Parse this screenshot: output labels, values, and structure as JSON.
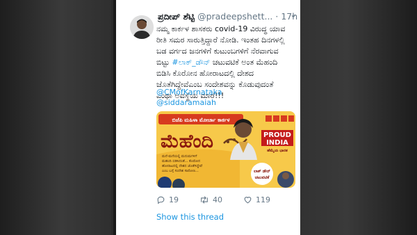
{
  "tweet": {
    "name": "ಪ್ರದೀಪ್ ಶೆಟ್ಟಿ",
    "handle": "@pradeepshett...",
    "dot": "·",
    "time": "17h",
    "body_line1": "ನಮ್ಮ ಕಾರ್ಕಳ ಶಾಸಕರು covid-19 ವಿರುದ್ಧ ಯಾವ",
    "body_line2": "ರೀತಿ ಸಮರ ಸಾರುತ್ತಿದ್ದಾರೆ ನೋಡಿ. ಇಂತಹ ದಿನಗಳಲ್ಲಿ",
    "body_line3": "ಬಡ ವರ್ಗದ ಜನಗಳಿಗೆ ಕುಟುಂಬಗಳಿಗೆ ನೆರವಾಗುವ",
    "body_line4_pre": "ಬಿಟ್ಟು ",
    "hashtag": "#ಲಾಕ್_ಡೌನ್",
    "body_line4_post": " ಚಟುವಟಿಕೆ ಅಂತ ಮೆಹಂದಿ",
    "body_line5": "ಬಿಡಿಸಿ ಕೊರೋನ ಹೋರಾಟದಲ್ಲಿ ದೇಶದ",
    "body_line6": "ಜೊತೆಗಿದ್ದೇವೆಎಂಬ ಸಂದೇಶವನ್ನು ಕೊಡುವುದಂತೆ",
    "body_line7": "ಎಂಥಾ ಅವಸ್ಥೆಯ ಮಾರೆ!!!",
    "mention1": "@CMofKarnataka",
    "mention2": "@siddaramaiah"
  },
  "media": {
    "banner_text": "ಬಿಜೆಪಿ ಮಹಿಳಾ ಮೋರ್ಚಾ ಕಾರ್ಕಳ",
    "title": "ಮೆಹೆಂದಿ",
    "caption_line1": "ಮನೆ-ಮನೆಯಲ್ಲಿ ಮದುಮಗಳಿಗೆ",
    "caption_line2": "ಮಹಂದಿ ಬಿಡಿಸಿದಂತೆ... ಕೊರೋನ",
    "caption_line3": "ಹೋರಾಟದಲ್ಲಿ ದೇಶದ ಜೊತೆಗಿದ್ದೇವೆ",
    "caption_line4": "ಎಂಬ ಬಗ್ಗೆ ಸಂದೇಶ ಸಾರೋಣ...",
    "badge_line1": "PROUD",
    "badge_line2": "INDIA",
    "badge_sub": "ಹೆಮ್ಮೆಯ ಭಾರತ",
    "lock_line1": "ಲಾಕ್ ಡೌನ್",
    "lock_line2": "ಚಟುವಟಿಕೆ"
  },
  "actions": {
    "replies": "19",
    "retweets": "40",
    "likes": "119"
  },
  "show_thread": "Show this thread",
  "colors": {
    "link": "#1b95e0",
    "muted": "#657786",
    "media_bg": "#f7c94a",
    "badge_red": "#c41b1b"
  }
}
